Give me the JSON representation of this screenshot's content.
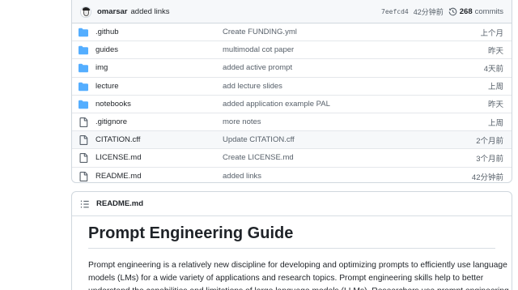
{
  "commit": {
    "author": "omarsar",
    "message": "added links",
    "sha": "7eefcd4",
    "time": "42分钟前",
    "history_count": "268",
    "history_label": "commits"
  },
  "files": [
    {
      "type": "folder",
      "name": ".github",
      "message": "Create FUNDING.yml",
      "time": "上个月"
    },
    {
      "type": "folder",
      "name": "guides",
      "message": "multimodal cot paper",
      "time": "昨天"
    },
    {
      "type": "folder",
      "name": "img",
      "message": "added active prompt",
      "time": "4天前"
    },
    {
      "type": "folder",
      "name": "lecture",
      "message": "add lecture slides",
      "time": "上周"
    },
    {
      "type": "folder",
      "name": "notebooks",
      "message": "added application example PAL",
      "time": "昨天"
    },
    {
      "type": "file",
      "name": ".gitignore",
      "message": "more notes",
      "time": "上周"
    },
    {
      "type": "file",
      "name": "CITATION.cff",
      "message": "Update CITATION.cff",
      "time": "2个月前"
    },
    {
      "type": "file",
      "name": "LICENSE.md",
      "message": "Create LICENSE.md",
      "time": "3个月前"
    },
    {
      "type": "file",
      "name": "README.md",
      "message": "added links",
      "time": "42分钟前"
    }
  ],
  "readme": {
    "filename": "README.md",
    "heading": "Prompt Engineering Guide",
    "paragraph": "Prompt engineering is a relatively new discipline for developing and optimizing prompts to efficiently use language models (LMs) for a wide variety of applications and research topics. Prompt engineering skills help to better understand the capabilities and limitations of large language models (LLMs). Researchers use prompt engineering"
  },
  "colors": {
    "folder": "#54aeff",
    "file": "#57606a",
    "border": "#d0d7de"
  }
}
